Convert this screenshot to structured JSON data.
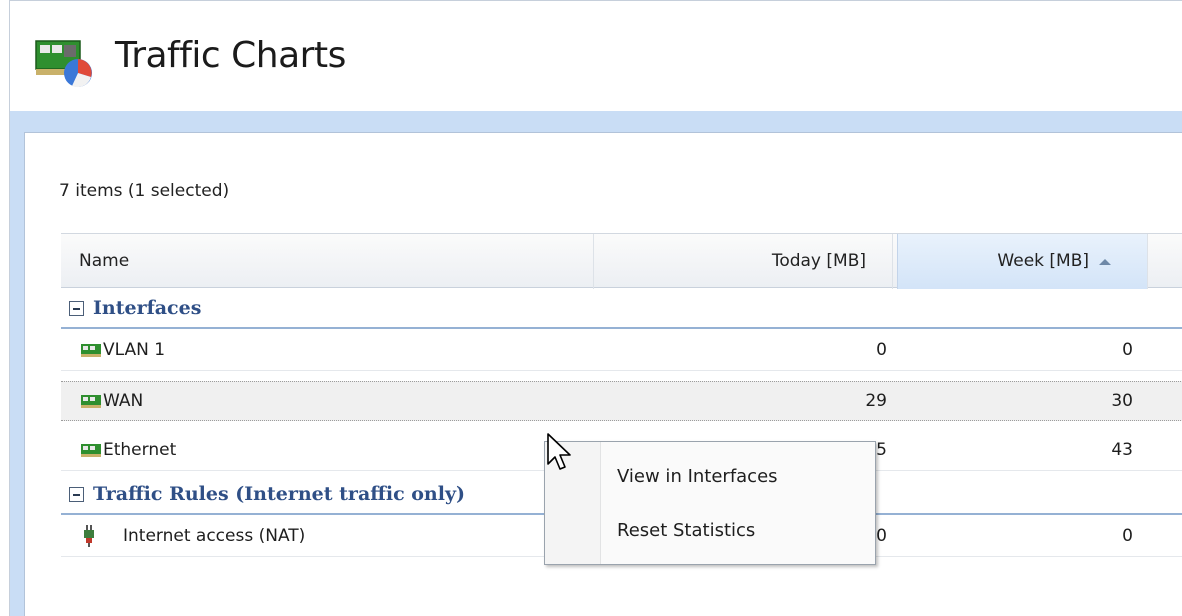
{
  "header": {
    "title": "Traffic Charts",
    "icon": "network-traffic-chart-icon"
  },
  "list": {
    "items_count": "7 items (1 selected)"
  },
  "columns": {
    "name": "Name",
    "today": "Today [MB]",
    "week": "Week [MB]",
    "sorted_column": "week",
    "sort_direction": "ascending"
  },
  "groups": [
    {
      "label": "Interfaces",
      "rows": [
        {
          "name": "VLAN 1",
          "today": "0",
          "week": "0",
          "icon": "network-card-icon"
        },
        {
          "name": "WAN",
          "today": "29",
          "week": "30",
          "icon": "network-card-icon",
          "selected": true
        },
        {
          "name": "Ethernet",
          "today": "5",
          "week": "43",
          "icon": "network-card-icon"
        }
      ]
    },
    {
      "label": "Traffic Rules (Internet traffic only)",
      "rows": [
        {
          "name": "Internet access (NAT)",
          "today": "0",
          "week": "0",
          "icon": "traffic-rule-plug-icon"
        }
      ]
    }
  ],
  "context_menu": {
    "items": [
      "View in Interfaces",
      "Reset Statistics"
    ]
  },
  "colors": {
    "accent_blue": "#c9ddf5",
    "group_text": "#2f4f86",
    "selection": "#f0f0f0"
  }
}
